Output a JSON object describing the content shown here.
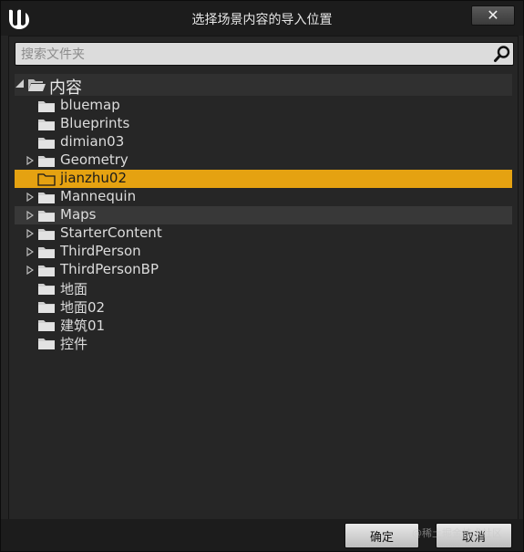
{
  "window": {
    "title": "选择场景内容的导入位置",
    "close_label": "✕"
  },
  "search": {
    "placeholder": "搜索文件夹",
    "value": ""
  },
  "tree": {
    "root_label": "内容",
    "items": [
      {
        "label": "bluemap",
        "expandable": false,
        "state": ""
      },
      {
        "label": "Blueprints",
        "expandable": false,
        "state": ""
      },
      {
        "label": "dimian03",
        "expandable": false,
        "state": ""
      },
      {
        "label": "Geometry",
        "expandable": true,
        "state": ""
      },
      {
        "label": "jianzhu02",
        "expandable": false,
        "state": "selected"
      },
      {
        "label": "Mannequin",
        "expandable": true,
        "state": ""
      },
      {
        "label": "Maps",
        "expandable": true,
        "state": "hover"
      },
      {
        "label": "StarterContent",
        "expandable": true,
        "state": ""
      },
      {
        "label": "ThirdPerson",
        "expandable": true,
        "state": ""
      },
      {
        "label": "ThirdPersonBP",
        "expandable": true,
        "state": ""
      },
      {
        "label": "地面",
        "expandable": false,
        "state": ""
      },
      {
        "label": "地面02",
        "expandable": false,
        "state": ""
      },
      {
        "label": "建筑01",
        "expandable": false,
        "state": ""
      },
      {
        "label": "控件",
        "expandable": false,
        "state": ""
      }
    ]
  },
  "footer": {
    "ok_label": "确定",
    "cancel_label": "取消",
    "watermark": "@稀土掘金技术社区"
  },
  "colors": {
    "selection": "#e5a211",
    "background": "#262626",
    "folder": "#cfcfcf"
  }
}
